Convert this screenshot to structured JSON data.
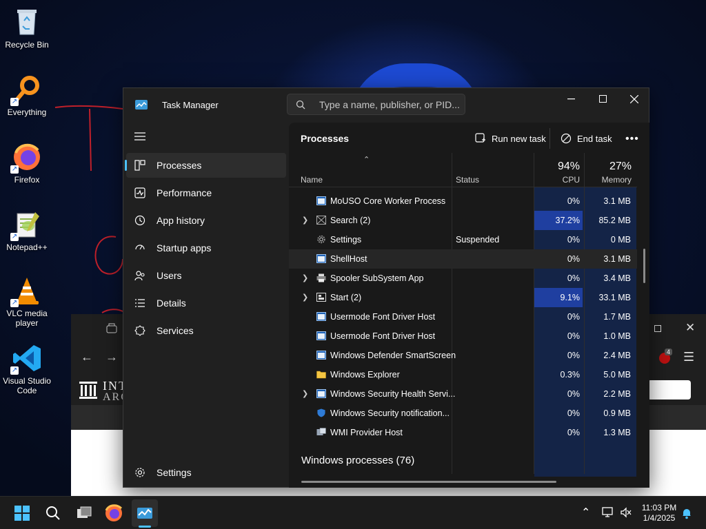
{
  "desktop": {
    "icons": [
      {
        "label": "Recycle Bin"
      },
      {
        "label": "Everything"
      },
      {
        "label": "Firefox"
      },
      {
        "label": "Notepad++"
      },
      {
        "label": "VLC media player"
      },
      {
        "label": "Visual Studio Code"
      }
    ]
  },
  "browser": {
    "badge": "4",
    "logo_text_1": "INT",
    "logo_text_2": "ARC"
  },
  "task_manager": {
    "title": "Task Manager",
    "search_placeholder": "Type a name, publisher, or PID...",
    "nav": [
      {
        "label": "Processes",
        "icon": "processes-icon",
        "active": true
      },
      {
        "label": "Performance",
        "icon": "performance-icon"
      },
      {
        "label": "App history",
        "icon": "history-icon"
      },
      {
        "label": "Startup apps",
        "icon": "startup-icon"
      },
      {
        "label": "Users",
        "icon": "users-icon"
      },
      {
        "label": "Details",
        "icon": "details-icon"
      },
      {
        "label": "Services",
        "icon": "services-icon"
      }
    ],
    "settings_label": "Settings",
    "page_title": "Processes",
    "run_new_task": "Run new task",
    "end_task": "End task",
    "columns": {
      "name": "Name",
      "status": "Status",
      "cpu_pct": "94%",
      "cpu": "CPU",
      "mem_pct": "27%",
      "memory": "Memory"
    },
    "rows": [
      {
        "name": "MoUSO Core Worker Process",
        "status": "",
        "cpu": "0%",
        "mem": "3.1 MB",
        "expand": false,
        "icon": "window"
      },
      {
        "name": "Search (2)",
        "status": "",
        "cpu": "37.2%",
        "mem": "85.2 MB",
        "expand": true,
        "icon": "search-app"
      },
      {
        "name": "Settings",
        "status": "Suspended",
        "cpu": "0%",
        "mem": "0 MB",
        "expand": false,
        "icon": "gear"
      },
      {
        "name": "ShellHost",
        "status": "",
        "cpu": "0%",
        "mem": "3.1 MB",
        "expand": false,
        "icon": "window"
      },
      {
        "name": "Spooler SubSystem App",
        "status": "",
        "cpu": "0%",
        "mem": "3.4 MB",
        "expand": true,
        "icon": "printer"
      },
      {
        "name": "Start (2)",
        "status": "",
        "cpu": "9.1%",
        "mem": "33.1 MB",
        "expand": true,
        "icon": "start-app"
      },
      {
        "name": "Usermode Font Driver Host",
        "status": "",
        "cpu": "0%",
        "mem": "1.7 MB",
        "expand": false,
        "icon": "window"
      },
      {
        "name": "Usermode Font Driver Host",
        "status": "",
        "cpu": "0%",
        "mem": "1.0 MB",
        "expand": false,
        "icon": "window"
      },
      {
        "name": "Windows Defender SmartScreen",
        "status": "",
        "cpu": "0%",
        "mem": "2.4 MB",
        "expand": false,
        "icon": "window"
      },
      {
        "name": "Windows Explorer",
        "status": "",
        "cpu": "0.3%",
        "mem": "5.0 MB",
        "expand": false,
        "icon": "folder"
      },
      {
        "name": "Windows Security Health Servi...",
        "status": "",
        "cpu": "0%",
        "mem": "2.2 MB",
        "expand": true,
        "icon": "window"
      },
      {
        "name": "Windows Security notification...",
        "status": "",
        "cpu": "0%",
        "mem": "0.9 MB",
        "expand": false,
        "icon": "shield"
      },
      {
        "name": "WMI Provider Host",
        "status": "",
        "cpu": "0%",
        "mem": "1.3 MB",
        "expand": false,
        "icon": "wmi"
      }
    ],
    "group_label": "Windows processes (76)"
  },
  "taskbar": {
    "time": "11:03 PM",
    "date": "1/4/2025"
  }
}
